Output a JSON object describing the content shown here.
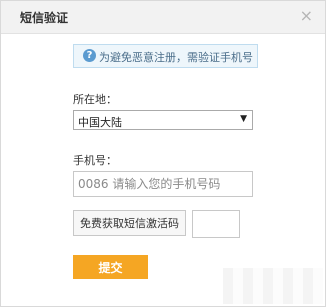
{
  "dialog": {
    "title": "短信验证",
    "close_symbol": "×"
  },
  "notice": {
    "icon": "info-icon",
    "icon_glyph": "?",
    "text": "为避免恶意注册，需验证手机号"
  },
  "location": {
    "label": "所在地：",
    "selected": "中国大陆",
    "arrow": "▼"
  },
  "phone": {
    "label": "手机号：",
    "placeholder": "0086 请输入您的手机号码",
    "value": ""
  },
  "sms": {
    "button_label": "免费获取短信激活码",
    "code_value": ""
  },
  "submit": {
    "label": "提交",
    "color": "#f5a623"
  }
}
